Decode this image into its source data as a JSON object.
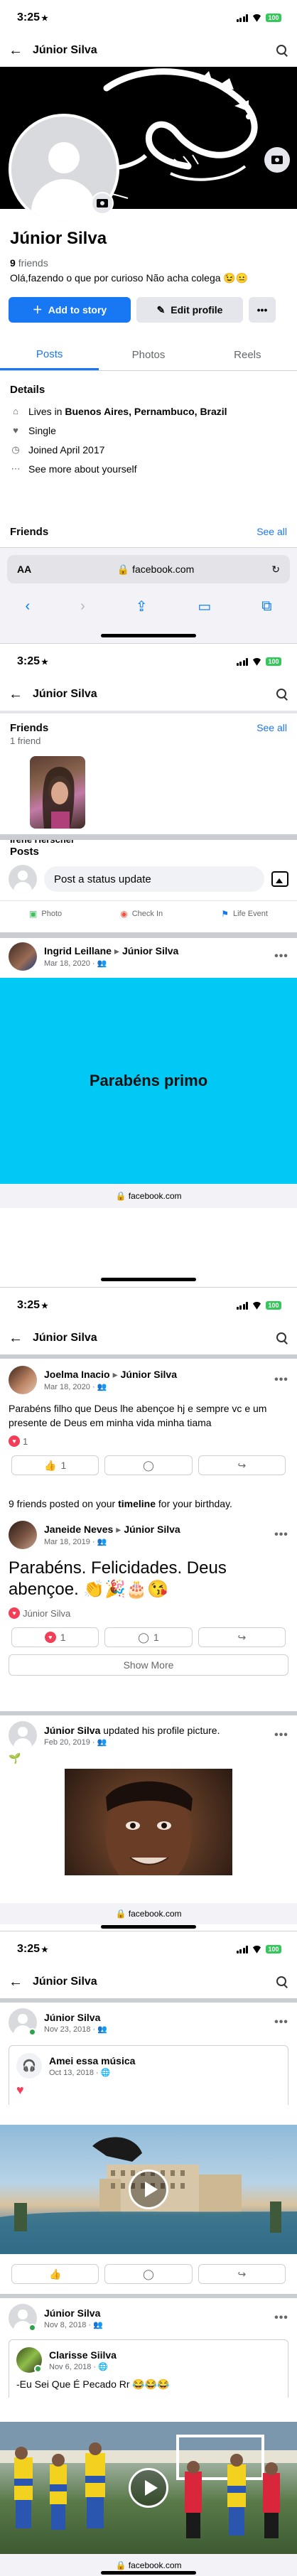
{
  "status_bar": {
    "time": "3:25",
    "battery": "100"
  },
  "shot1": {
    "nav": {
      "title": "Júnior Silva"
    },
    "profile": {
      "name": "Júnior Silva",
      "friends_count": "9",
      "friends_word": "friends",
      "bio": "Olá,fazendo o que por curioso Não acha colega 😉😐"
    },
    "actions": {
      "add_story": "Add to story",
      "edit_profile": "Edit profile",
      "more": "•••"
    },
    "tabs": [
      "Posts",
      "Photos",
      "Reels"
    ],
    "details": {
      "heading": "Details",
      "lives_prefix": "Lives in ",
      "lives_place": "Buenos Aires, Pernambuco, Brazil",
      "relationship": "Single",
      "joined": "Joined April 2017",
      "see_more": "See more about yourself"
    },
    "friends_section": {
      "heading": "Friends",
      "see_all": "See all"
    },
    "safari": {
      "aa": "AA",
      "url": "facebook.com"
    }
  },
  "shot2": {
    "nav": {
      "title": "Júnior Silva"
    },
    "friends": {
      "heading": "Friends",
      "count": "1 friend",
      "see_all": "See all",
      "friend_name": "Irene Herschel"
    },
    "posts": {
      "heading": "Posts",
      "status_placeholder": "Post a status update",
      "quick": [
        "Photo",
        "Check In",
        "Life Event"
      ]
    },
    "post": {
      "author": "Ingrid Leillane",
      "target": "Júnior Silva",
      "date": "Mar 18, 2020",
      "card_text": "Parabéns primo"
    },
    "url": "facebook.com"
  },
  "shot3": {
    "nav": {
      "title": "Júnior Silva"
    },
    "post1": {
      "author": "Joelma Inacio",
      "target": "Júnior Silva",
      "date": "Mar 18, 2020",
      "text": "Parabéns filho que Deus lhe abençoe hj e sempre vc e um presente de Deus em minha vida minha tiama",
      "reactions": "1"
    },
    "birthday": {
      "prefix": "9 friends posted on your ",
      "bold": "timeline",
      "suffix": " for your birthday."
    },
    "post2": {
      "author": "Janeide Neves",
      "target": "Júnior Silva",
      "date": "Mar 18, 2019",
      "text": "Parabéns. Felicidades. Deus abençoe. 👏🎉🎂😘",
      "reacted_by": "Júnior Silva",
      "likes": "1",
      "comments": "1"
    },
    "show_more": "Show More",
    "post3": {
      "author": "Júnior Silva",
      "action": " updated his profile picture.",
      "date": "Feb 20, 2019"
    },
    "url": "facebook.com"
  },
  "shot4": {
    "nav": {
      "title": "Júnior Silva"
    },
    "post1": {
      "author": "Júnior Silva",
      "date": "Nov 23, 2018",
      "shared_title": "Amei essa música",
      "shared_date": "Oct 13, 2018"
    },
    "post2": {
      "author": "Júnior Silva",
      "date": "Nov 8, 2018",
      "shared_author": "Clarisse Siilva",
      "shared_date": "Nov 6, 2018",
      "shared_text": "-Eu Sei Que É Pecado Rr 😂😂😂"
    },
    "url": "facebook.com"
  },
  "colors": {
    "brand_blue": "#1877f2",
    "cyan_card": "#00c9f5",
    "online": "#31a24c",
    "heart": "#f33e58"
  }
}
